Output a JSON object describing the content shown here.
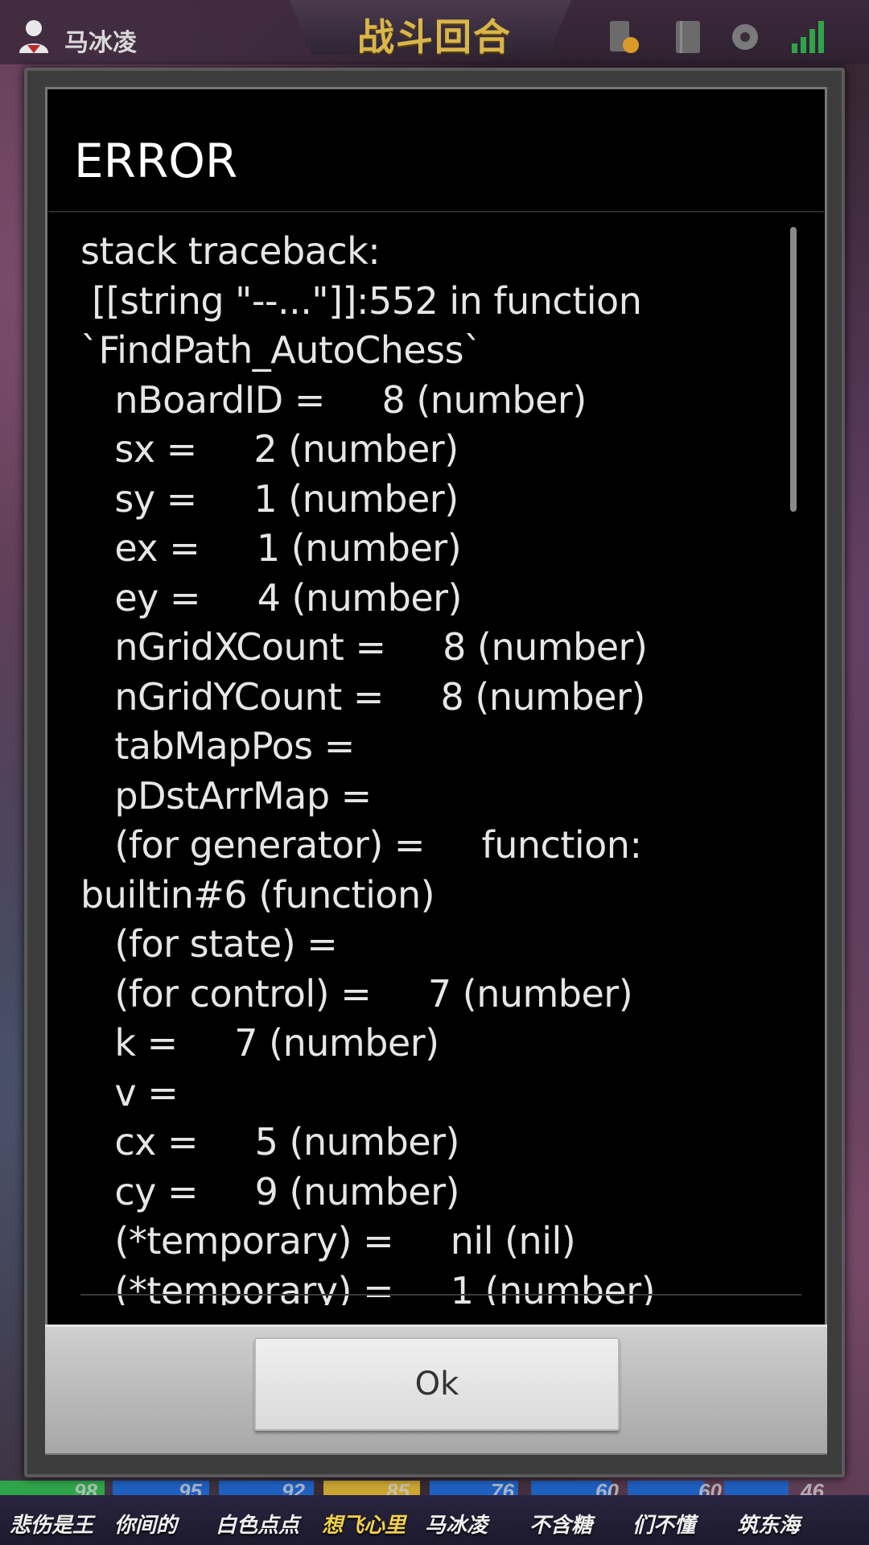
{
  "game": {
    "player_name": "马冰凌",
    "phase_title": "战斗回合",
    "bottom_players": [
      {
        "name": "悲伤是王",
        "hp": "98",
        "active": false
      },
      {
        "name": "你间的",
        "hp": "95",
        "active": false
      },
      {
        "name": "白色点点",
        "hp": "92",
        "active": false
      },
      {
        "name": "想飞心里",
        "hp": "85",
        "active": true
      },
      {
        "name": "马冰凌",
        "hp": "76",
        "active": false
      },
      {
        "name": "不含糖",
        "hp": "60",
        "active": false
      },
      {
        "name": "们不懂",
        "hp": "60",
        "active": false
      },
      {
        "name": "筑东海",
        "hp": "46",
        "active": false
      }
    ]
  },
  "dialog": {
    "title": "ERROR",
    "message": "stack traceback:\n [[string \"--...\"]]:552 in function\n`FindPath_AutoChess`\n   nBoardID =     8 (number)\n   sx =     2 (number)\n   sy =     1 (number)\n   ex =     1 (number)\n   ey =     4 (number)\n   nGridXCount =     8 (number)\n   nGridYCount =     8 (number)\n   tabMapPos =\n   pDstArrMap =\n   (for generator) =     function:\nbuiltin#6 (function)\n   (for state) =\n   (for control) =     7 (number)\n   k =     7 (number)\n   v =\n   cx =     5 (number)\n   cy =     9 (number)\n   (*temporary) =     nil (nil)\n   (*temporary) =     1 (number)",
    "ok_label": "Ok"
  }
}
